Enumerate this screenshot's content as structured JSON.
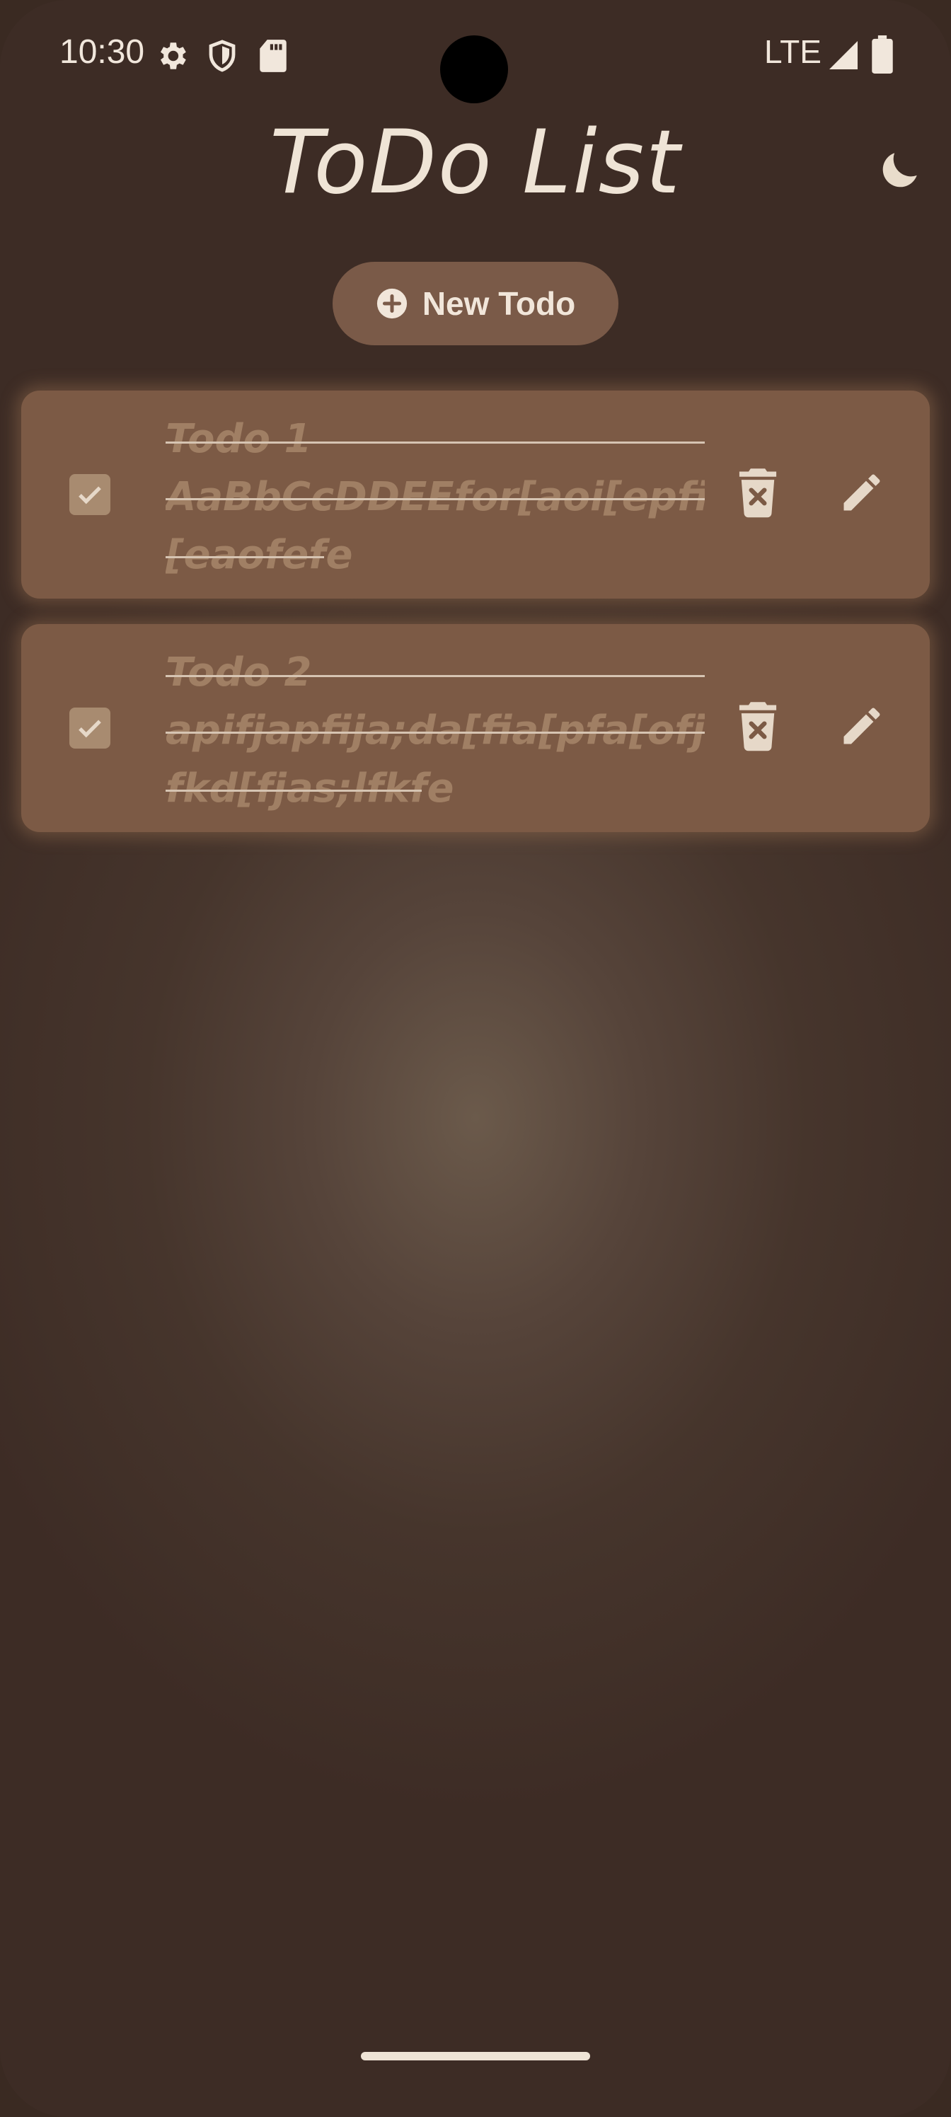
{
  "status_bar": {
    "time": "10:30",
    "icons": [
      "settings-icon",
      "shield-icon",
      "sd-card-icon"
    ],
    "network": "LTE",
    "right_icons": [
      "signal-icon",
      "battery-icon"
    ]
  },
  "header": {
    "title": "ToDo List",
    "theme_toggle_icon": "moon-icon"
  },
  "new_todo_button": {
    "label": "New Todo",
    "icon": "plus-circle-icon"
  },
  "todos": [
    {
      "checked": true,
      "title": "Todo 1",
      "lines": [
        "AaBbCcDDEEfor[aoi[epfi",
        "[eaofefe"
      ]
    },
    {
      "checked": true,
      "title": "Todo 2",
      "lines": [
        "apifjapfija;da[fia[pfa[ofjdl;",
        "fkd[fjas;lfkfe"
      ]
    }
  ],
  "colors": {
    "background": "#46352c",
    "card": "#7c5a45",
    "text_light": "#efe4d6",
    "text_muted": "#a07f64"
  }
}
